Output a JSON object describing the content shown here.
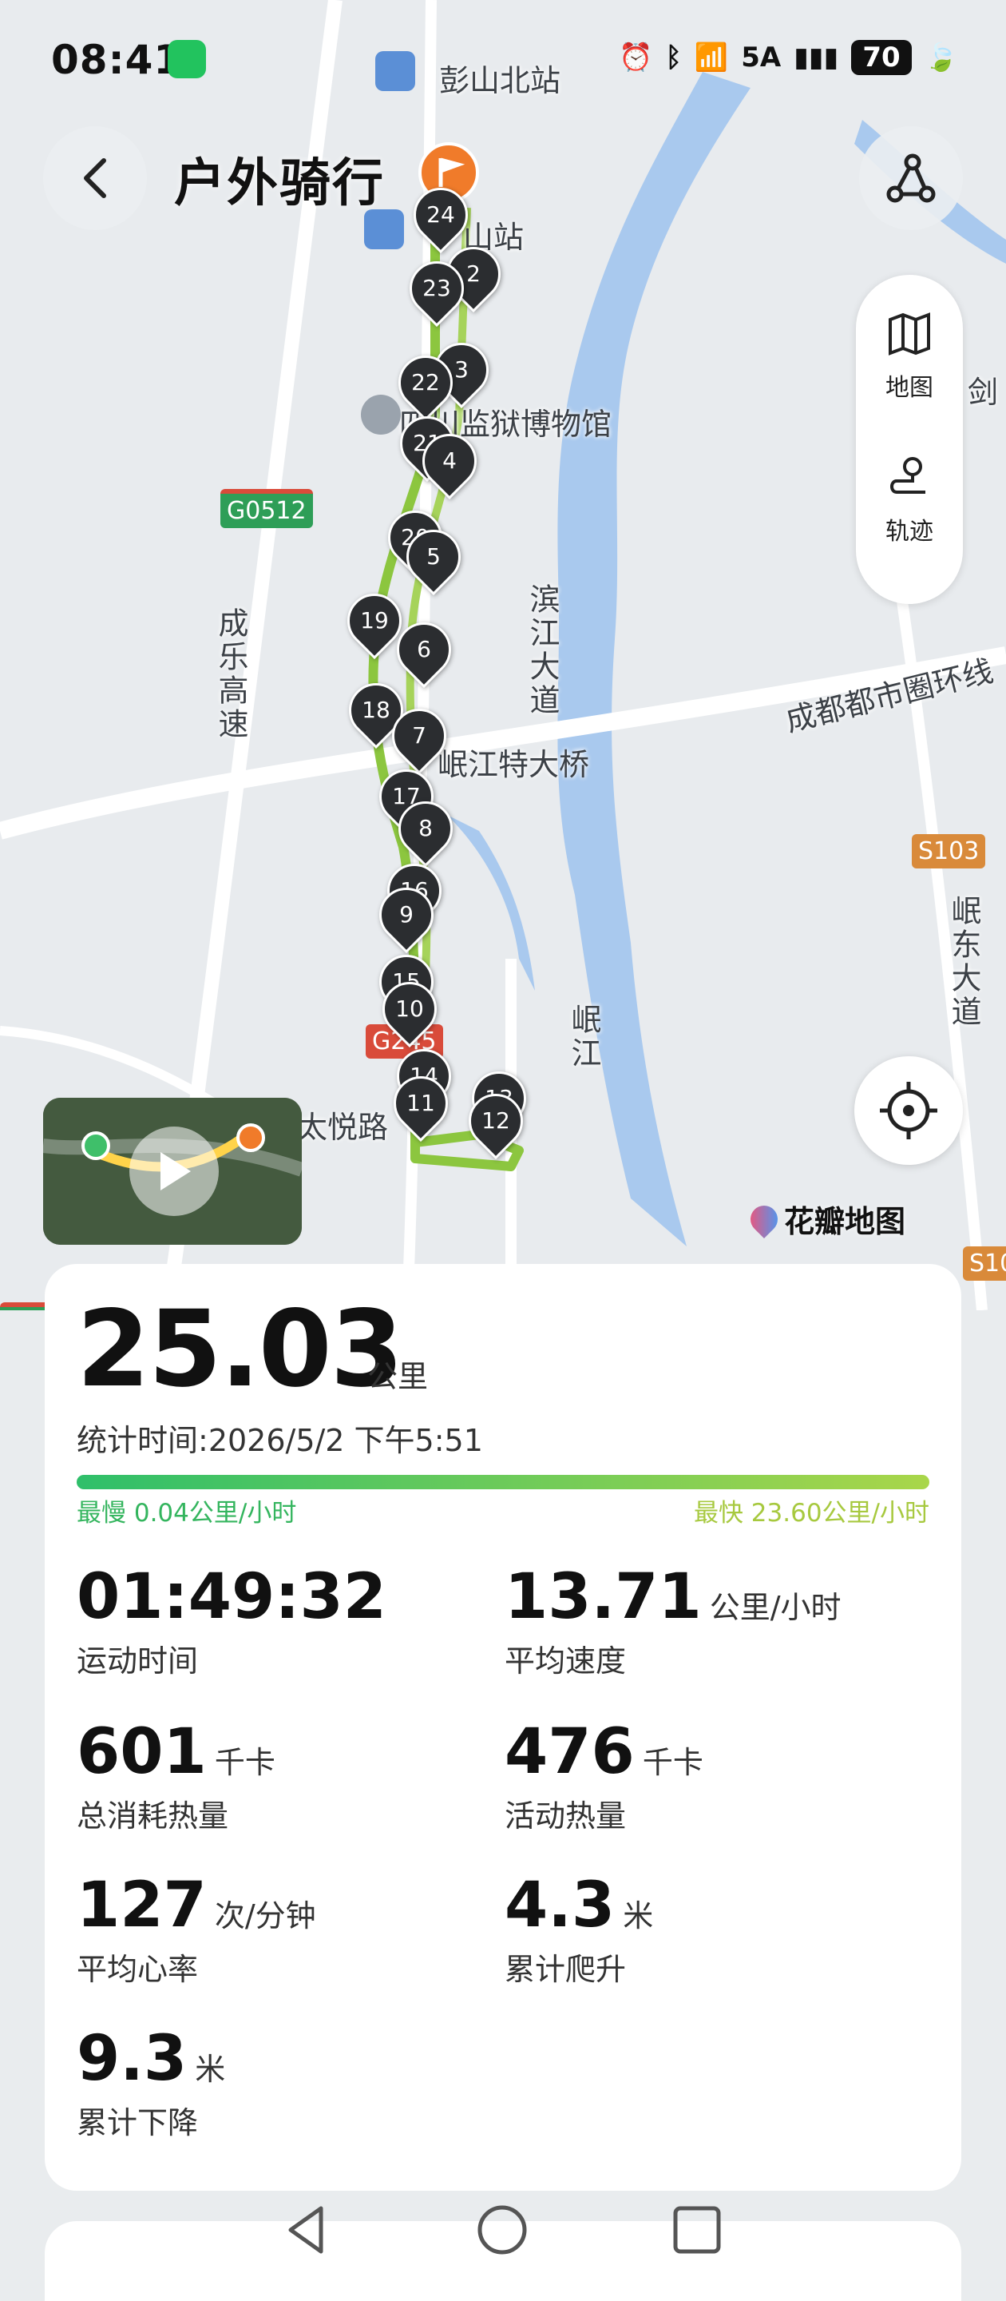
{
  "status_bar": {
    "time": "08:41",
    "network": "5A",
    "battery": "70",
    "icons": [
      "wechat-icon",
      "alarm-icon",
      "bluetooth-icon",
      "wifi-icon",
      "signal-icon",
      "battery-icon",
      "leaf-icon"
    ]
  },
  "header": {
    "title": "户外骑行"
  },
  "map": {
    "labels": {
      "pengshan_north": "彭山北站",
      "station_partial": "山站",
      "museum": "四川监狱博物馆",
      "highway_g0512": "G0512",
      "chengle": "成乐高速",
      "binjiang": "滨江大道",
      "minjiang_bridge": "岷江特大桥",
      "ring_road": "成都都市圈环线",
      "s103": "S103",
      "mindong": "岷东大道",
      "g245": "G245",
      "taiyue": "太悦路",
      "minjiang": "岷江",
      "jian": "剑",
      "s10": "S10",
      "g512": "512"
    },
    "side_panel": {
      "map_label": "地图",
      "track_label": "轨迹"
    },
    "brand": "花瓣地图",
    "pins": [
      "24",
      "2",
      "23",
      "3",
      "22",
      "21",
      "4",
      "20",
      "5",
      "19",
      "6",
      "18",
      "7",
      "17",
      "8",
      "16",
      "9",
      "15",
      "10",
      "14",
      "11",
      "13",
      "12"
    ]
  },
  "stats": {
    "distance": "25.03",
    "distance_unit": "公里",
    "time_label": "统计时间:",
    "time_value": "2026/5/2 下午5:51",
    "slowest": "最慢 0.04公里/小时",
    "fastest": "最快 23.60公里/小时",
    "metrics": [
      {
        "value": "01:49:32",
        "unit": "",
        "label": "运动时间"
      },
      {
        "value": "13.71",
        "unit": "公里/小时",
        "label": "平均速度"
      },
      {
        "value": "601",
        "unit": "千卡",
        "label": "总消耗热量"
      },
      {
        "value": "476",
        "unit": "千卡",
        "label": "活动热量"
      },
      {
        "value": "127",
        "unit": "次/分钟",
        "label": "平均心率"
      },
      {
        "value": "4.3",
        "unit": "米",
        "label": "累计爬升"
      },
      {
        "value": "9.3",
        "unit": "米",
        "label": "累计下降"
      }
    ]
  },
  "colors": {
    "track": "#8cc63f",
    "river": "#a9c9ee",
    "accent_orange": "#f07b2a"
  }
}
